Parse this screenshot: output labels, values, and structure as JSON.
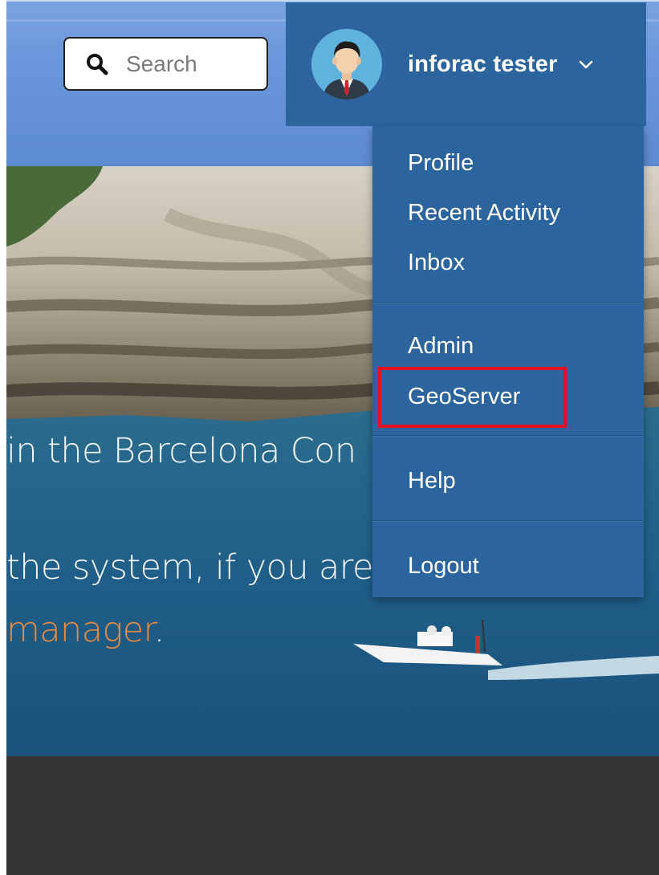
{
  "search": {
    "placeholder": "Search"
  },
  "user": {
    "name": "inforac tester"
  },
  "menu": {
    "items": [
      {
        "label": "Profile"
      },
      {
        "label": "Recent Activity"
      },
      {
        "label": "Inbox"
      },
      {
        "label": "Admin"
      },
      {
        "label": "GeoServer"
      },
      {
        "label": "Help"
      },
      {
        "label": "Logout"
      }
    ],
    "highlighted": "GeoServer"
  },
  "hero": {
    "line1": "in the Barcelona Con",
    "line2": "the system, if you are",
    "line3_link": "manager",
    "line3_suffix": "."
  },
  "icons": {
    "search": "search-icon",
    "avatar": "user-avatar",
    "dropdown": "chevron-down-icon"
  },
  "colors": {
    "menu_bg": "#2c659d",
    "header_bg": "#6d98dc",
    "highlight_border": "#e3101f",
    "link": "#e98a3f",
    "footer_bg": "#333333"
  }
}
